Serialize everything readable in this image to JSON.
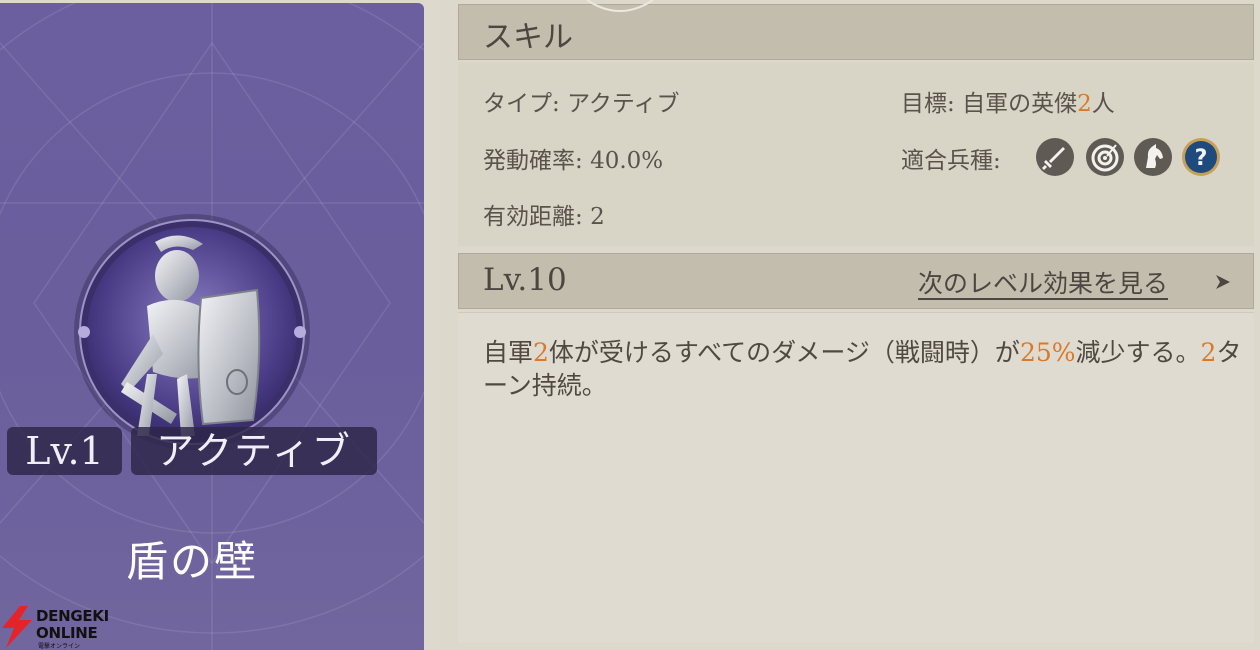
{
  "skill_card": {
    "level": "Lv.1",
    "type": "アクティブ",
    "name": "盾の壁",
    "logo": {
      "line1": "DENGEKI",
      "line2": "ONLINE",
      "line3": "電撃オンライン"
    }
  },
  "skill_panel": {
    "header": "スキル",
    "type_label": "タイプ:",
    "type_value": "アクティブ",
    "target_label": "目標:",
    "target_prefix": "自軍の英傑",
    "target_count": "2",
    "target_suffix": "人",
    "chance_label": "発動確率:",
    "chance_value": "40.0%",
    "units_label": "適合兵種:",
    "units": [
      {
        "icon": "sword-icon",
        "color": "#5f5a54"
      },
      {
        "icon": "bow-target-icon",
        "color": "#5f5a54"
      },
      {
        "icon": "horse-icon",
        "color": "#5f5a54"
      },
      {
        "icon": "question-icon",
        "color": "#1f4a7d"
      }
    ],
    "range_label": "有効距離:",
    "range_value": "2"
  },
  "level_section": {
    "level": "Lv.10",
    "next_link": "次のレベル効果を見る"
  },
  "description": {
    "p1": "自軍",
    "n1": "2",
    "p2": "体が受けるすべてのダメージ（戦闘時）が",
    "n2": "25%",
    "p3": "減少する。",
    "n3": "2",
    "p4": "ターン持続。"
  },
  "colors": {
    "highlight": "#d87a2a",
    "card_purple": "#6b5fa0",
    "panel_bg": "#dcd8cb"
  }
}
